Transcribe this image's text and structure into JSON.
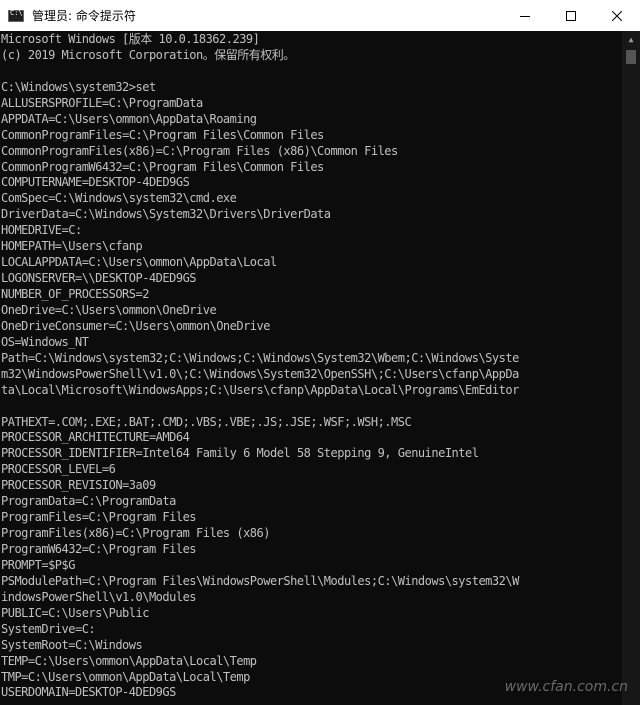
{
  "window": {
    "title": "管理员: 命令提示符",
    "icon": "cmd-icon",
    "controls": {
      "minimize_icon": "minimize-icon",
      "maximize_icon": "maximize-icon",
      "close_icon": "close-icon"
    }
  },
  "console": {
    "lines": [
      "Microsoft Windows [版本 10.0.18362.239]",
      "(c) 2019 Microsoft Corporation。保留所有权利。",
      "",
      "C:\\Windows\\system32>set",
      "ALLUSERSPROFILE=C:\\ProgramData",
      "APPDATA=C:\\Users\\ommon\\AppData\\Roaming",
      "CommonProgramFiles=C:\\Program Files\\Common Files",
      "CommonProgramFiles(x86)=C:\\Program Files (x86)\\Common Files",
      "CommonProgramW6432=C:\\Program Files\\Common Files",
      "COMPUTERNAME=DESKTOP-4DED9GS",
      "ComSpec=C:\\Windows\\system32\\cmd.exe",
      "DriverData=C:\\Windows\\System32\\Drivers\\DriverData",
      "HOMEDRIVE=C:",
      "HOMEPATH=\\Users\\cfanp",
      "LOCALAPPDATA=C:\\Users\\ommon\\AppData\\Local",
      "LOGONSERVER=\\\\DESKTOP-4DED9GS",
      "NUMBER_OF_PROCESSORS=2",
      "OneDrive=C:\\Users\\ommon\\OneDrive",
      "OneDriveConsumer=C:\\Users\\ommon\\OneDrive",
      "OS=Windows_NT",
      "Path=C:\\Windows\\system32;C:\\Windows;C:\\Windows\\System32\\Wbem;C:\\Windows\\Syste",
      "m32\\WindowsPowerShell\\v1.0\\;C:\\Windows\\System32\\OpenSSH\\;C:\\Users\\cfanp\\AppDa",
      "ta\\Local\\Microsoft\\WindowsApps;C:\\Users\\cfanp\\AppData\\Local\\Programs\\EmEditor",
      "",
      "PATHEXT=.COM;.EXE;.BAT;.CMD;.VBS;.VBE;.JS;.JSE;.WSF;.WSH;.MSC",
      "PROCESSOR_ARCHITECTURE=AMD64",
      "PROCESSOR_IDENTIFIER=Intel64 Family 6 Model 58 Stepping 9, GenuineIntel",
      "PROCESSOR_LEVEL=6",
      "PROCESSOR_REVISION=3a09",
      "ProgramData=C:\\ProgramData",
      "ProgramFiles=C:\\Program Files",
      "ProgramFiles(x86)=C:\\Program Files (x86)",
      "ProgramW6432=C:\\Program Files",
      "PROMPT=$P$G",
      "PSModulePath=C:\\Program Files\\WindowsPowerShell\\Modules;C:\\Windows\\system32\\W",
      "indowsPowerShell\\v1.0\\Modules",
      "PUBLIC=C:\\Users\\Public",
      "SystemDrive=C:",
      "SystemRoot=C:\\Windows",
      "TEMP=C:\\Users\\ommon\\AppData\\Local\\Temp",
      "TMP=C:\\Users\\ommon\\AppData\\Local\\Temp",
      "USERDOMAIN=DESKTOP-4DED9GS"
    ]
  },
  "watermark": "www.cfan.com.cn",
  "colors": {
    "background": "#0c0c0c",
    "text": "#c0c0c0",
    "titlebar": "#ffffff"
  }
}
